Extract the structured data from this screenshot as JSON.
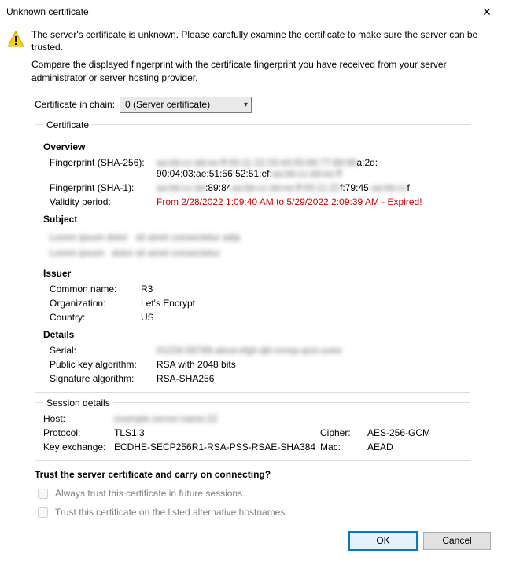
{
  "window": {
    "title": "Unknown certificate"
  },
  "intro": {
    "line1": "The server's certificate is unknown. Please carefully examine the certificate to make sure the server can be trusted.",
    "line2": "Compare the displayed fingerprint with the certificate fingerprint you have received from your server administrator or server hosting provider."
  },
  "chain": {
    "label": "Certificate in chain:",
    "selected": "0 (Server certificate)"
  },
  "certGroup": {
    "legend": "Certificate",
    "overview": {
      "header": "Overview",
      "fpr256_label": "Fingerprint (SHA-256):",
      "fpr256_line1_masked": "aa:bb:cc:dd:ee:ff:00:11:22:33:44:55:66:77:88:99",
      "fpr256_line1_tail": "a:2d:",
      "fpr256_line2_pre": "90:04:03:ae:51:56:52:51:ef:",
      "fpr256_line2_masked": "aa:bb:cc:dd:ee:ff",
      "fpr1_label": "Fingerprint (SHA-1):",
      "fpr1_pre_masked": "aa:bb:cc:dd",
      "fpr1_mid": ":89:84",
      "fpr1_mid_masked": "aa:bb:cc:dd:ee:ff:00:11:22",
      "fpr1_tail": "f:79:45:",
      "fpr1_tail_masked": "aa:bb:cc",
      "fpr1_end": "f",
      "validity_label": "Validity period:",
      "validity_value": "From 2/28/2022 1:09:40 AM to 5/29/2022 2:09:39 AM - Expired!"
    },
    "subject": {
      "header": "Subject",
      "line1_left": "Lorem ipsum dolor",
      "line1_right": "sit amet consectetur adip",
      "line2_left": "Lorem ipsum",
      "line2_right": "dolor sit amet consectetur"
    },
    "issuer": {
      "header": "Issuer",
      "cn_label": "Common name:",
      "cn_value": "R3",
      "org_label": "Organization:",
      "org_value": "Let's Encrypt",
      "country_label": "Country:",
      "country_value": "US"
    },
    "details": {
      "header": "Details",
      "serial_label": "Serial:",
      "serial_masked": "01234-56789-abcd-efgh-ijkl-mnop-qrst-uvwx",
      "pubkey_label": "Public key algorithm:",
      "pubkey_value": "RSA with 2048 bits",
      "sigalg_label": "Signature algorithm:",
      "sigalg_value": "RSA-SHA256"
    }
  },
  "session": {
    "legend": "Session details",
    "host_label": "Host:",
    "host_masked": "example.server.name:22",
    "proto_label": "Protocol:",
    "proto_value": "TLS1.3",
    "cipher_label": "Cipher:",
    "cipher_value": "AES-256-GCM",
    "kex_label": "Key exchange:",
    "kex_value": "ECDHE-SECP256R1-RSA-PSS-RSAE-SHA384",
    "mac_label": "Mac:",
    "mac_value": "AEAD"
  },
  "trust": {
    "question": "Trust the server certificate and carry on connecting?",
    "cb1": "Always trust this certificate in future sessions.",
    "cb2": "Trust this certificate on the listed alternative hostnames."
  },
  "buttons": {
    "ok": "OK",
    "cancel": "Cancel"
  }
}
